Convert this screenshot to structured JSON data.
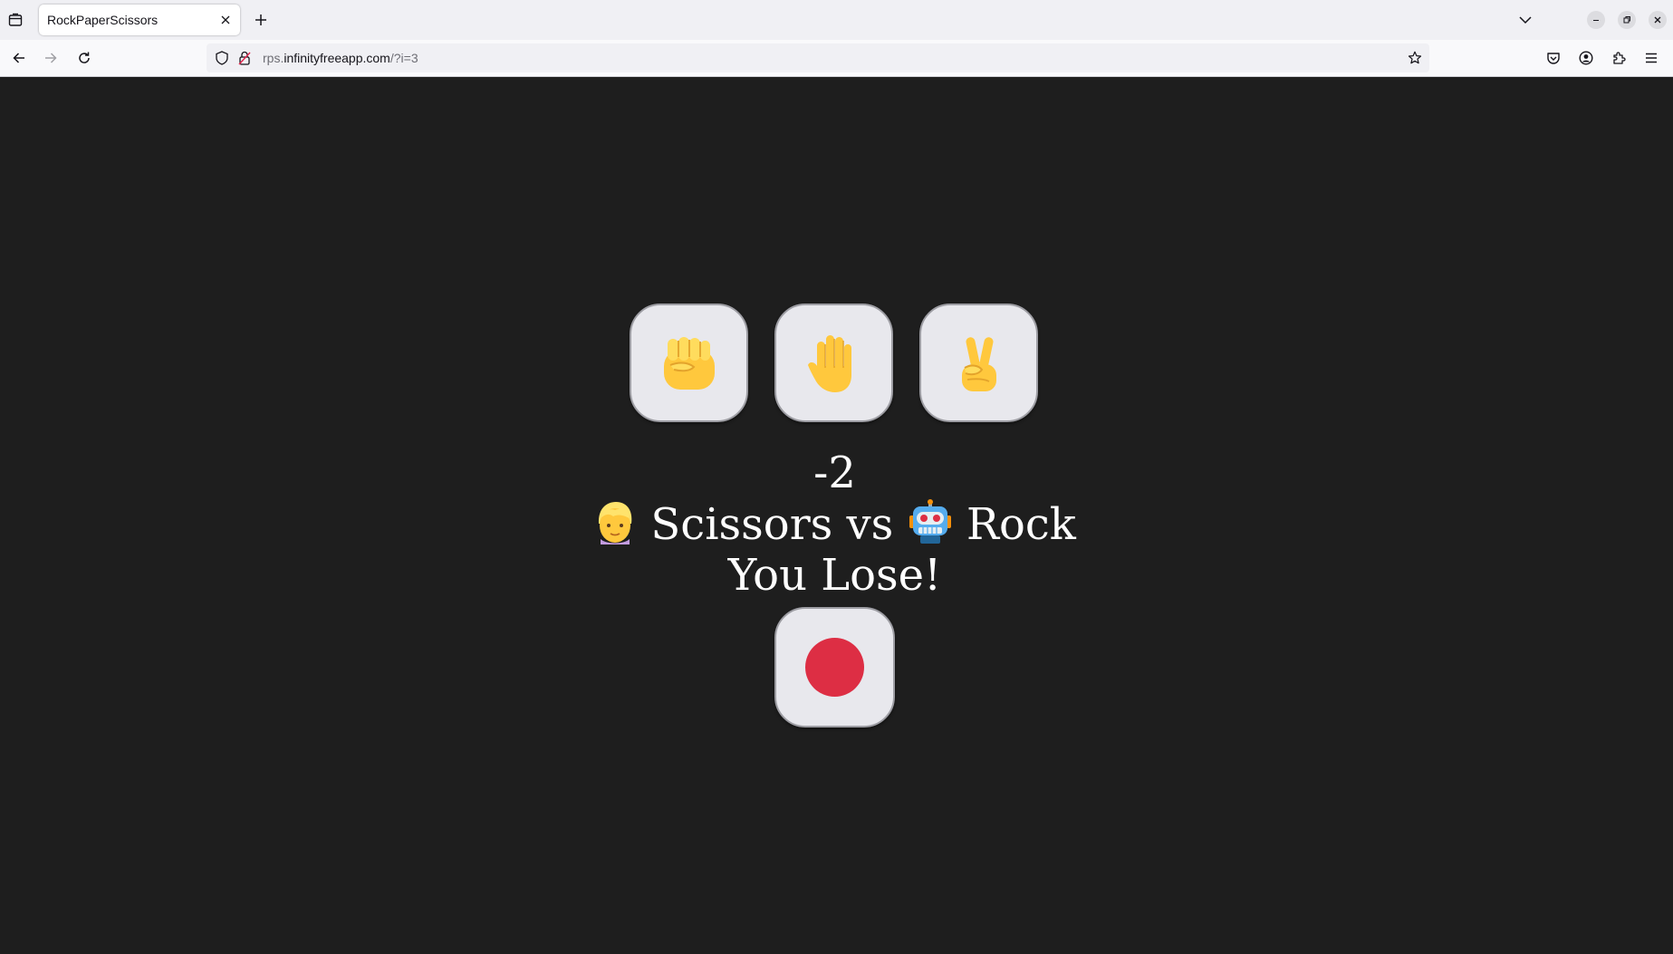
{
  "browser": {
    "tab_title": "RockPaperScissors",
    "url_prefix": "rps.",
    "url_domain": "infinityfreeapp.com",
    "url_path": "/?i=3"
  },
  "game": {
    "choices": [
      {
        "name": "Rock",
        "icon": "raised-fist"
      },
      {
        "name": "Paper",
        "icon": "raised-hand"
      },
      {
        "name": "Scissors",
        "icon": "victory-hand"
      }
    ],
    "score": "-2",
    "player_icon": "person-blond-hair",
    "player_choice": "Scissors",
    "vs_text": "vs",
    "cpu_icon": "robot",
    "cpu_choice": "Rock",
    "result": "You Lose!",
    "colors": {
      "background": "#1e1e1e",
      "button_face": "#e8e8ed",
      "record_dot": "#dd2e44",
      "text": "#ffffff"
    }
  }
}
